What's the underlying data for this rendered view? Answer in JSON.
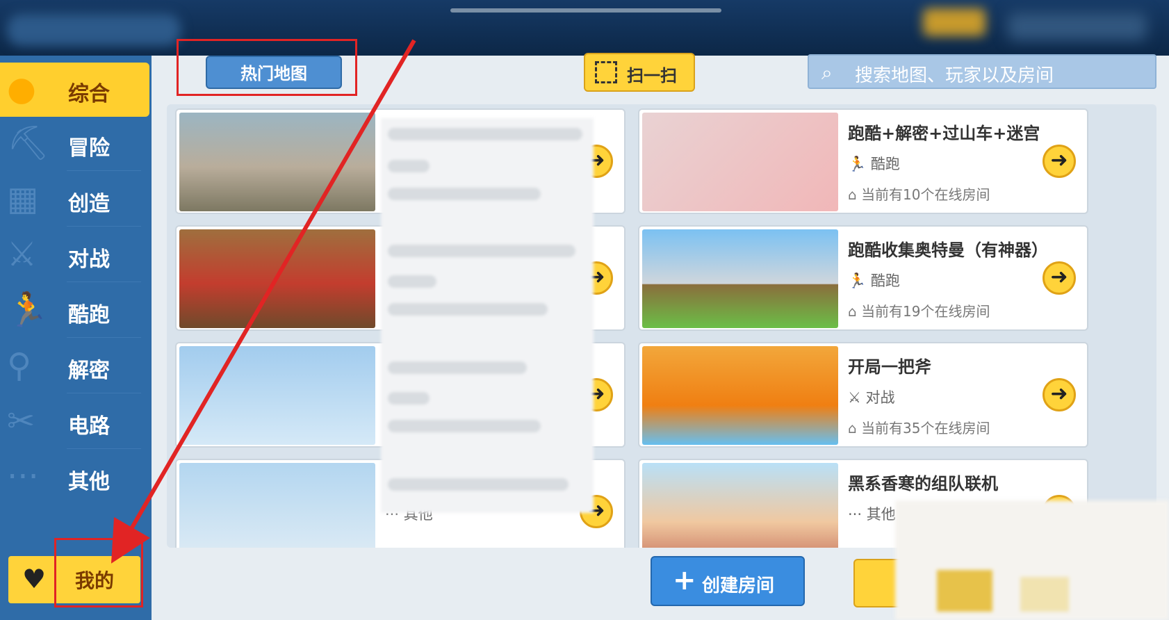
{
  "sidebar": {
    "items": [
      {
        "label": "综合",
        "icon": "flame-icon"
      },
      {
        "label": "冒险",
        "icon": "pickaxe-icon"
      },
      {
        "label": "创造",
        "icon": "building-icon"
      },
      {
        "label": "对战",
        "icon": "crossed-swords-icon"
      },
      {
        "label": "酷跑",
        "icon": "runner-icon"
      },
      {
        "label": "解密",
        "icon": "key-icon"
      },
      {
        "label": "电路",
        "icon": "tools-icon"
      },
      {
        "label": "其他",
        "icon": "dots-icon"
      }
    ],
    "active_index": 0,
    "mine_label": "我的"
  },
  "toolbar": {
    "hot_maps_label": "热门地图",
    "scan_label": "扫一扫",
    "search_placeholder": "搜索地图、玩家以及房间"
  },
  "cards": [
    {
      "title": "跑酷+解密+过山车+迷宫",
      "tag": "酷跑",
      "rooms": "当前有10个在线房间"
    },
    {
      "title": "跑酷收集奥特曼（有神器）",
      "tag": "酷跑",
      "rooms": "当前有19个在线房间"
    },
    {
      "title": "开局一把斧",
      "tag": "对战",
      "rooms": "当前有35个在线房间"
    },
    {
      "title": "黑系香寒的组队联机",
      "tag": "其他",
      "rooms": ""
    }
  ],
  "left_cards": [
    {
      "tag": ""
    },
    {
      "tag": ""
    },
    {
      "tag": ""
    },
    {
      "tag": "其他"
    }
  ],
  "footer": {
    "create_room_label": "创建房间"
  },
  "colors": {
    "accent_yellow": "#ffd33a",
    "sidebar_blue": "#2f6ca8",
    "annotation_red": "#e12424"
  }
}
